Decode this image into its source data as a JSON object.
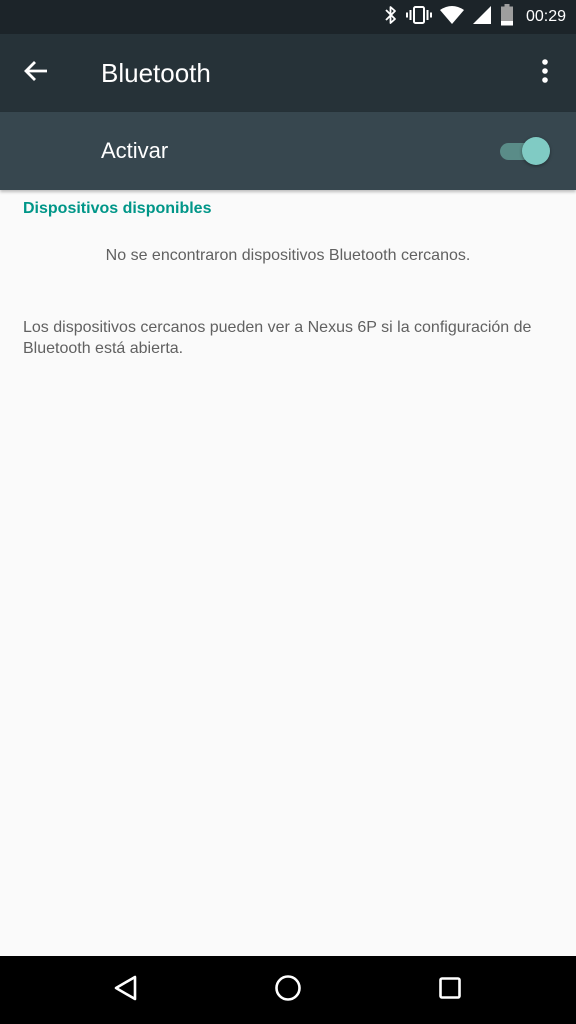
{
  "status_bar": {
    "time": "00:29",
    "icons": [
      "bluetooth-icon",
      "vibrate-icon",
      "wifi-icon",
      "signal-icon",
      "battery-icon"
    ]
  },
  "app_bar": {
    "title": "Bluetooth",
    "back_icon": "arrow-back-icon",
    "overflow_icon": "more-vert-icon"
  },
  "switch_bar": {
    "label": "Activar",
    "checked": true
  },
  "content": {
    "section_header": "Dispositivos disponibles",
    "empty_message": "No se encontraron dispositivos Bluetooth cercanos.",
    "footer_message": "Los dispositivos cercanos pueden ver a Nexus 6P si la configuración de Bluetooth está abierta."
  },
  "nav_bar": {
    "icons": [
      "back-triangle-icon",
      "home-circle-icon",
      "recents-square-icon"
    ]
  },
  "colors": {
    "status_bar": "#1c2429",
    "app_bar": "#263238",
    "switch_bar": "#37474f",
    "accent": "#009688",
    "toggle_thumb": "#80cbc4",
    "background": "#fafafa"
  }
}
